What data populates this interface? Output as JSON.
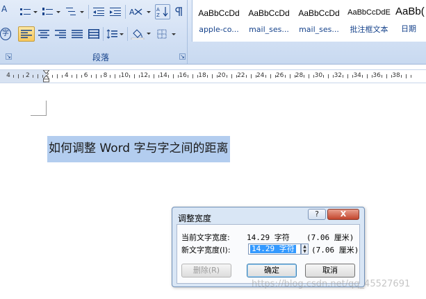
{
  "ribbon": {
    "paragraph_group_label": "段落",
    "left_edge_glyphs": [
      "A",
      "字"
    ],
    "styles": [
      {
        "sample": "AaBbCcDd",
        "name": "apple-co..."
      },
      {
        "sample": "AaBbCcDd",
        "name": "mail_ses..."
      },
      {
        "sample": "AaBbCcDd",
        "name": "mail_ses..."
      },
      {
        "sample": "AaBbCcDdE",
        "name": "批注框文本"
      },
      {
        "sample": "AaBb(",
        "name": "日期"
      }
    ]
  },
  "ruler": {
    "labels": [
      "4",
      "2",
      "2",
      "4",
      "6",
      "8",
      "10",
      "12",
      "14",
      "16",
      "18",
      "20",
      "22",
      "24",
      "26",
      "28",
      "30",
      "32",
      "34",
      "36",
      "38"
    ]
  },
  "document": {
    "selected_text": "如何调整 Word 字与字之间的距离"
  },
  "dialog": {
    "title": "调整宽度",
    "help_label": "?",
    "close_label": "X",
    "current_width_label": "当前文字宽度:",
    "current_width_value": "14.29 字符",
    "current_width_alt": "(7.06 厘米)",
    "new_width_label": "新文字宽度(I):",
    "new_width_value": "14.29 字符",
    "new_width_alt": "(7.06 厘米)",
    "delete_button": "删除(R)",
    "ok_button": "确定",
    "cancel_button": "取消"
  },
  "watermark": "https://blog.csdn.net/qq_45527691"
}
